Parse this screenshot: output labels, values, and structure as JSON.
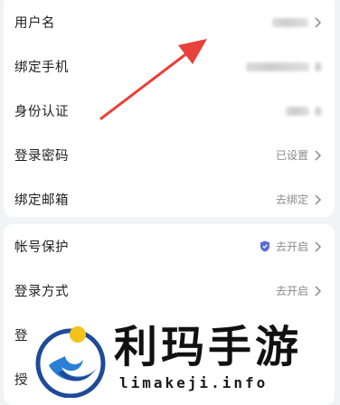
{
  "account_card": {
    "username": {
      "label": "用户名"
    },
    "phone": {
      "label": "绑定手机"
    },
    "identity": {
      "label": "身份认证"
    },
    "password": {
      "label": "登录密码",
      "value": "已设置"
    },
    "email": {
      "label": "绑定邮箱",
      "value": "去绑定"
    }
  },
  "security_card": {
    "protection": {
      "label": "帐号保护",
      "value": "去开启",
      "icon": "shield-icon",
      "icon_color": "#5b6bd6"
    },
    "login_method": {
      "label": "登录方式",
      "value": "去开启"
    },
    "row3": {
      "label": "登"
    },
    "row4": {
      "label": "授"
    }
  },
  "watermark": {
    "title": "利玛手游",
    "url": "limakeji.info"
  },
  "colors": {
    "page_bg": "#f2f3f5",
    "card_bg": "#ffffff",
    "arrow": "#e8403a"
  }
}
